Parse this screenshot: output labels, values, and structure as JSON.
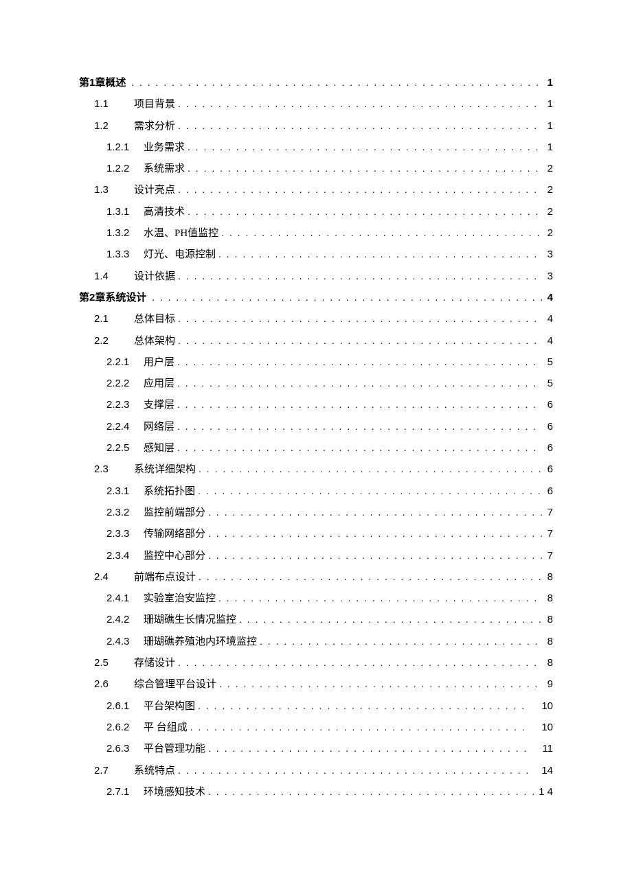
{
  "toc": [
    {
      "level": 0,
      "num": "",
      "title": "第1章概述",
      "page": "1",
      "bold": true
    },
    {
      "level": 1,
      "num": "1.1",
      "title": "项目背景",
      "page": "1"
    },
    {
      "level": 1,
      "num": "1.2",
      "title": "需求分析",
      "page": "1"
    },
    {
      "level": 2,
      "num": "1.2.1",
      "title": "业务需求",
      "page": "1"
    },
    {
      "level": 2,
      "num": "1.2.2",
      "title": "系统需求",
      "page": "2"
    },
    {
      "level": 1,
      "num": "1.3",
      "title": "设计亮点",
      "page": "2"
    },
    {
      "level": 2,
      "num": "1.3.1",
      "title": "高清技术",
      "page": "2"
    },
    {
      "level": 2,
      "num": "1.3.2",
      "title": "水温、PH值监控",
      "page": "2"
    },
    {
      "level": 2,
      "num": "1.3.3",
      "title": "灯光、电源控制",
      "page": "3"
    },
    {
      "level": 1,
      "num": "1.4",
      "title": "设计依据",
      "page": "3"
    },
    {
      "level": 0,
      "num": "",
      "title": "第2章系统设计",
      "page": "4",
      "bold": true
    },
    {
      "level": 1,
      "num": "2.1",
      "title": "总体目标",
      "page": "4"
    },
    {
      "level": 1,
      "num": "2.2",
      "title": "总体架构",
      "page": "4"
    },
    {
      "level": 2,
      "num": "2.2.1",
      "title": "用户层",
      "page": "5"
    },
    {
      "level": 2,
      "num": "2.2.2",
      "title": "应用层",
      "page": "5"
    },
    {
      "level": 2,
      "num": "2.2.3",
      "title": "支撑层",
      "page": "6"
    },
    {
      "level": 2,
      "num": "2.2.4",
      "title": "网络层",
      "page": "6"
    },
    {
      "level": 2,
      "num": "2.2.5",
      "title": "感知层",
      "page": "6"
    },
    {
      "level": 1,
      "num": "2.3",
      "title": "系统详细架构",
      "page": "6"
    },
    {
      "level": 2,
      "num": "2.3.1",
      "title": "系统拓扑图",
      "page": "6"
    },
    {
      "level": 2,
      "num": "2.3.2",
      "title": "监控前端部分",
      "page": "7"
    },
    {
      "level": 2,
      "num": "2.3.3",
      "title": "传输网络部分",
      "page": "7"
    },
    {
      "level": 2,
      "num": "2.3.4",
      "title": "监控中心部分",
      "page": "7"
    },
    {
      "level": 1,
      "num": "2.4",
      "title": "前端布点设计",
      "page": "8"
    },
    {
      "level": 2,
      "num": "2.4.1",
      "title": "实验室治安监控",
      "page": "8"
    },
    {
      "level": 2,
      "num": "2.4.2",
      "title": "珊瑚礁生长情况监控",
      "page": "8"
    },
    {
      "level": 2,
      "num": "2.4.3",
      "title": "珊瑚礁养殖池内环境监控",
      "page": "8"
    },
    {
      "level": 1,
      "num": "2.5",
      "title": "存储设计",
      "page": "8"
    },
    {
      "level": 1,
      "num": "2.6",
      "title": "综合管理平台设计",
      "page": "9"
    },
    {
      "level": 2,
      "num": "2.6.1",
      "title": "平台架构图",
      "page": "10",
      "wide": true
    },
    {
      "level": 2,
      "num": "2.6.2",
      "title": "平 台组成",
      "page": "10",
      "wide": true
    },
    {
      "level": 2,
      "num": "2.6.3",
      "title": "平台管理功能",
      "page": "11",
      "wide": true
    },
    {
      "level": 1,
      "num": "2.7",
      "title": "系统特点",
      "page": "14",
      "wide": true
    },
    {
      "level": 2,
      "num": "2.7.1",
      "title": "环境感知技术",
      "page": "1 4"
    }
  ]
}
